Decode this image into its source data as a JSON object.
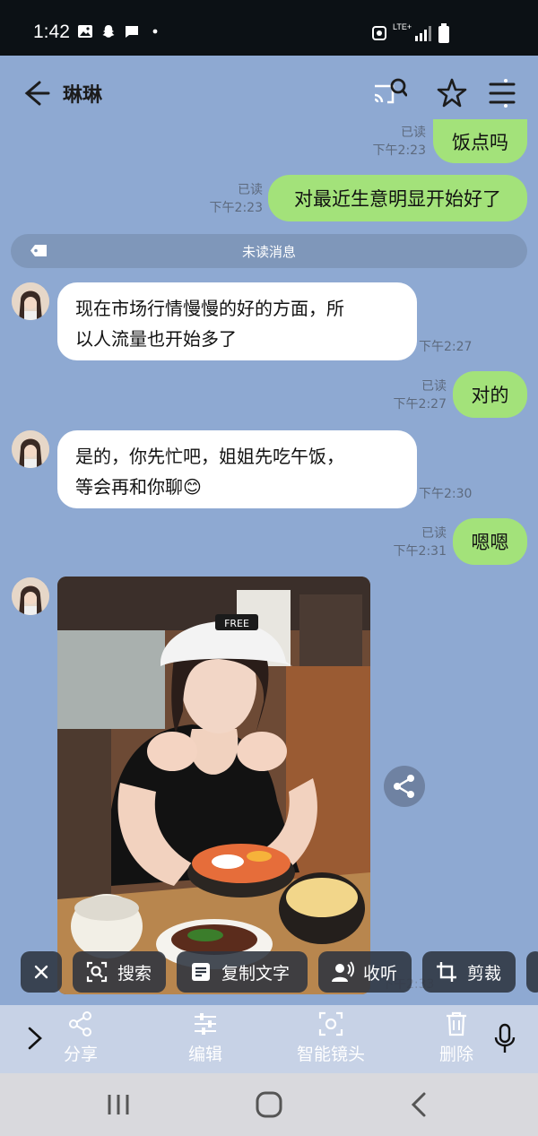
{
  "status_bar": {
    "time": "1:42",
    "network": "LTE+"
  },
  "header": {
    "title": "琳琳"
  },
  "messages": {
    "m1": {
      "text": "饭点吗",
      "read": "已读",
      "time": "下午2:23"
    },
    "m2": {
      "text": "对最近生意明显开始好了",
      "read": "已读",
      "time": "下午2:23"
    },
    "unread_divider": "未读消息",
    "m3": {
      "line1": "现在市场行情慢慢的好的方面，所",
      "line2": "以人流量也开始多了",
      "time": "下午2:27"
    },
    "m4": {
      "text": "对的",
      "read": "已读",
      "time": "下午2:27"
    },
    "m5": {
      "line1": "是的，你先忙吧，姐姐先吃午饭，",
      "line2": "等会再和你聊",
      "emoji": "😊",
      "time": "下午2:30"
    },
    "m6": {
      "text": "嗯嗯",
      "read": "已读",
      "time": "下午2:31"
    },
    "photo": {
      "cap_text": "FREE",
      "time_partial": "下午2:33"
    }
  },
  "lens_chips": {
    "search": "搜索",
    "copy_text": "复制文字",
    "listen": "收听",
    "crop": "剪裁"
  },
  "toolbar": {
    "share": "分享",
    "edit": "编辑",
    "smart_lens": "智能镜头",
    "delete": "删除"
  },
  "colors": {
    "outgoing_bubble": "#a3e27a",
    "incoming_bubble": "#ffffff",
    "chat_background": "#8ea9d2"
  }
}
